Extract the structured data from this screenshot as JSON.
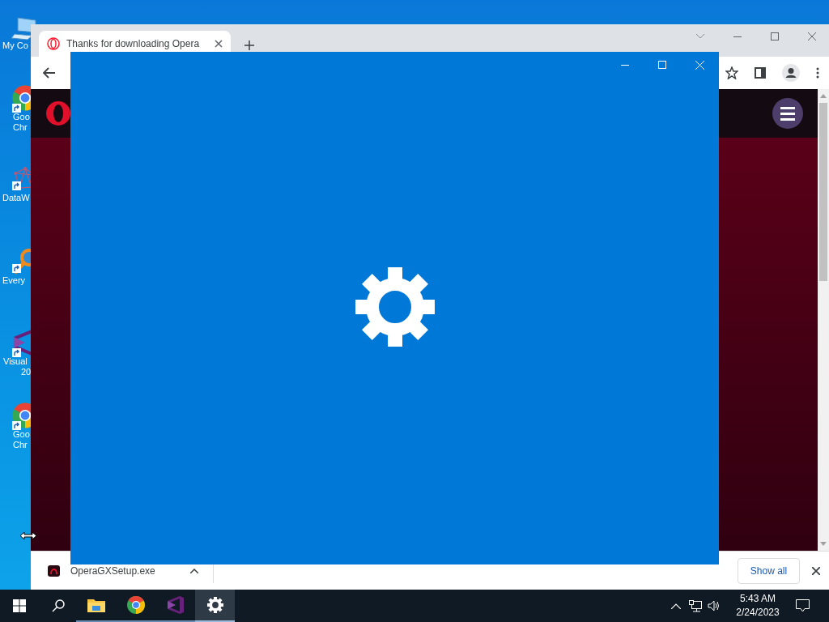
{
  "desktop_icons": [
    {
      "kind": "computer",
      "lines": [
        "My Co"
      ]
    },
    {
      "kind": "chrome",
      "lines": [
        "Goo",
        "Chr"
      ]
    },
    {
      "kind": "network",
      "lines": [
        "DataW"
      ]
    },
    {
      "kind": "magnifier",
      "lines": [
        "Every"
      ]
    },
    {
      "kind": "visualstudio",
      "lines": [
        "Visual",
        "20"
      ]
    },
    {
      "kind": "chrome",
      "lines": [
        "Goo",
        "Chr"
      ]
    }
  ],
  "browser": {
    "tab_title": "Thanks for downloading Opera",
    "download": {
      "file": "OperaGXSetup.exe"
    },
    "show_all": "Show all"
  },
  "taskbar": {
    "apps": [
      {
        "kind": "explorer",
        "selected": false
      },
      {
        "kind": "chrome",
        "selected": false
      },
      {
        "kind": "visualstudio",
        "selected": false
      },
      {
        "kind": "settings",
        "selected": true
      }
    ],
    "time": "5:43 AM",
    "date": "2/24/2023"
  }
}
